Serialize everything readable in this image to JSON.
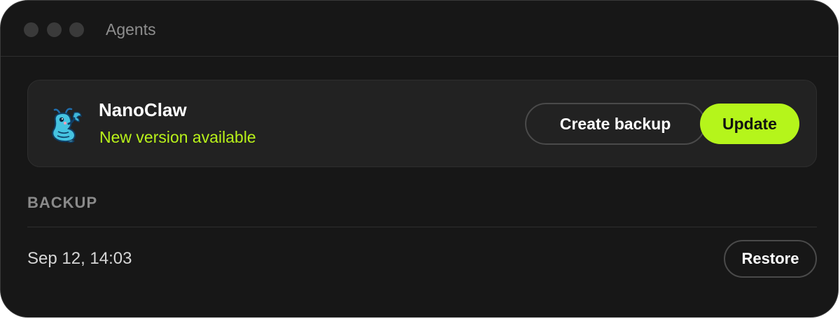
{
  "window": {
    "title": "Agents"
  },
  "agent": {
    "name": "NanoClaw",
    "status": "New version available",
    "logo_icon": "shrimp-mascot-icon",
    "create_backup_label": "Create backup",
    "update_label": "Update"
  },
  "backup_section": {
    "heading": "BACKUP",
    "items": [
      {
        "timestamp": "Sep 12, 14:03",
        "restore_label": "Restore"
      }
    ]
  },
  "colors": {
    "window_bg": "#171717",
    "card_bg": "#222222",
    "accent": "#b5f51b",
    "status_text": "#b9f21a",
    "muted_text": "#8a8a8a",
    "traffic_light": "#3a3a3a"
  }
}
